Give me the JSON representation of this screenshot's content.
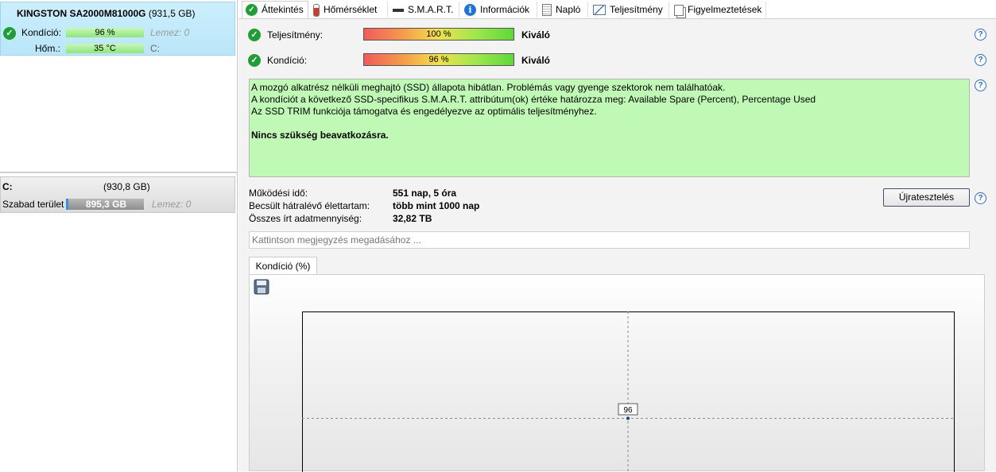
{
  "disk": {
    "name": "KINGSTON SA2000M81000G",
    "size": "(931,5 GB)",
    "condition_label": "Kondíció:",
    "condition_value": "96 %",
    "lemez": "Lemez: 0",
    "temp_label": "Hőm.:",
    "temp_value": "35 °C",
    "drive_letter": "C:"
  },
  "volume": {
    "letter": "C:",
    "size": "(930,8 GB)",
    "free_label": "Szabad terület",
    "free_value": "895,3 GB",
    "lemez": "Lemez: 0"
  },
  "tabs": [
    {
      "label": "Áttekintés",
      "icon": "check-icon"
    },
    {
      "label": "Hőmérséklet",
      "icon": "thermometer-icon"
    },
    {
      "label": "S.M.A.R.T.",
      "icon": "drive-icon"
    },
    {
      "label": "Információk",
      "icon": "info-icon"
    },
    {
      "label": "Napló",
      "icon": "log-icon"
    },
    {
      "label": "Teljesítmény",
      "icon": "performance-icon"
    },
    {
      "label": "Figyelmeztetések",
      "icon": "alerts-icon"
    }
  ],
  "overview": {
    "performance_label": "Teljesítmény:",
    "performance_value": "100 %",
    "performance_status": "Kiváló",
    "condition_label": "Kondíció:",
    "condition_value": "96 %",
    "condition_status": "Kiváló",
    "summary_lines": [
      "A mozgó alkatrész nélküli meghajtó (SSD) állapota hibátlan. Problémás vagy gyenge szektorok nem találhatóak.",
      "A kondíciót a következő SSD-specifikus S.M.A.R.T. attribútum(ok) értéke határozza meg:  Available Spare (Percent), Percentage Used",
      "Az SSD TRIM funkciója támogatva és engedélyezve az optimális teljesítményhez."
    ],
    "summary_bold": "Nincs szükség beavatkozásra.",
    "uptime_label": "Működési idő:",
    "uptime_value": "551 nap, 5 óra",
    "remaining_label": "Becsült hátralévő élettartam:",
    "remaining_value": "több mint 1000 nap",
    "written_label": "Összes írt adatmennyiség:",
    "written_value": "32,82 TB",
    "retest_label": "Újratesztelés",
    "note_placeholder": "Kattintson megjegyzés megadásához ...",
    "chart_tab_label": "Kondíció  (%)"
  },
  "colors": {
    "accent_blue": "#2a6bd1",
    "ok_green": "#1f9e36",
    "summary_bg": "#c0f9b5",
    "selected_card": "#cdeffc"
  },
  "chart_data": {
    "type": "scatter",
    "y_tick_label": "96",
    "points": [
      {
        "y": 96,
        "label": "96"
      }
    ]
  }
}
